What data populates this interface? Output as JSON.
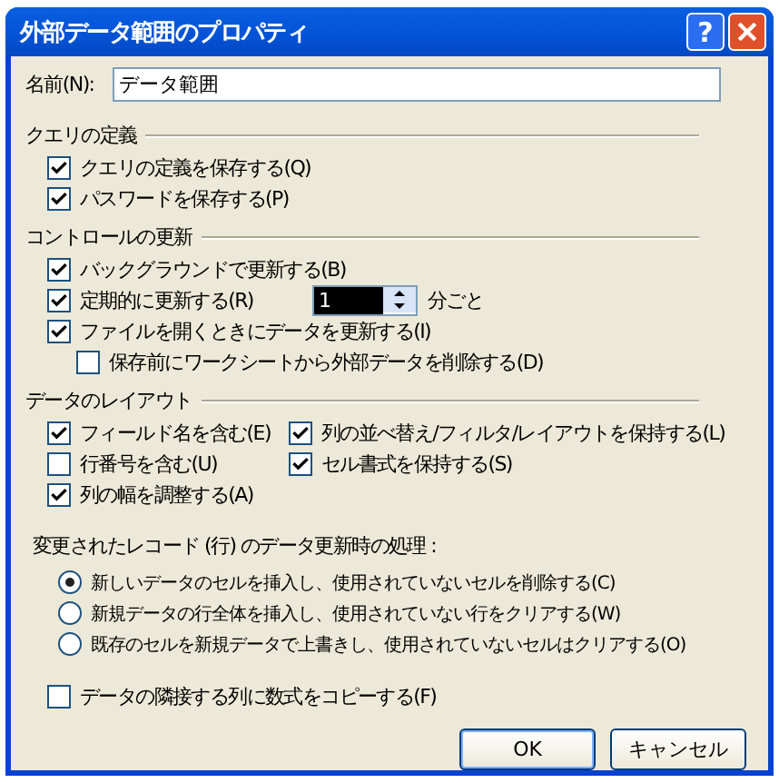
{
  "window": {
    "title": "外部データ範囲のプロパティ",
    "help_button": "?"
  },
  "name_field": {
    "label": "名前(N):",
    "value": "データ範囲"
  },
  "sections": [
    {
      "title": "クエリの定義",
      "items": [
        {
          "kind": "checkbox",
          "label": "クエリの定義を保存する(Q)",
          "checked": true
        },
        {
          "kind": "checkbox",
          "label": "パスワードを保存する(P)",
          "checked": true
        }
      ]
    },
    {
      "title": "コントロールの更新",
      "items": [
        {
          "kind": "checkbox",
          "label": "バックグラウンドで更新する(B)",
          "checked": true
        },
        {
          "kind": "spinner",
          "label": "定期的に更新する(R)",
          "checked": true,
          "value": "1",
          "suffix": "分ごと"
        },
        {
          "kind": "checkbox",
          "label": "ファイルを開くときにデータを更新する(I)",
          "checked": true,
          "children": [
            {
              "label": "保存前にワークシートから外部データを削除する(D)",
              "checked": false
            }
          ]
        }
      ]
    }
  ],
  "layout_section": {
    "title": "データのレイアウト",
    "columns": [
      [
        {
          "label": "フィールド名を含む(E)",
          "checked": true
        },
        {
          "label": "行番号を含む(U)",
          "checked": false
        },
        {
          "label": "列の幅を調整する(A)",
          "checked": true
        }
      ],
      [
        {
          "label": "列の並べ替え/フィルタ/レイアウトを保持する(L)",
          "checked": true
        },
        {
          "label": "セル書式を保持する(S)",
          "checked": true
        }
      ]
    ]
  },
  "refresh_handling": {
    "label": "変更されたレコード (行) のデータ更新時の処理 :",
    "options": [
      {
        "label": "新しいデータのセルを挿入し、使用されていないセルを削除する(C)",
        "selected": true
      },
      {
        "label": "新規データの行全体を挿入し、使用されていない行をクリアする(W)",
        "selected": false
      },
      {
        "label": "既存のセルを新規データで上書きし、使用されていないセルはクリアする(O)",
        "selected": false
      }
    ]
  },
  "copy_formulas": {
    "label": "データの隣接する列に数式をコピーする(F)",
    "checked": false
  },
  "buttons": [
    {
      "label": "OK",
      "default": true
    },
    {
      "label": "キャンセル",
      "default": false
    }
  ]
}
